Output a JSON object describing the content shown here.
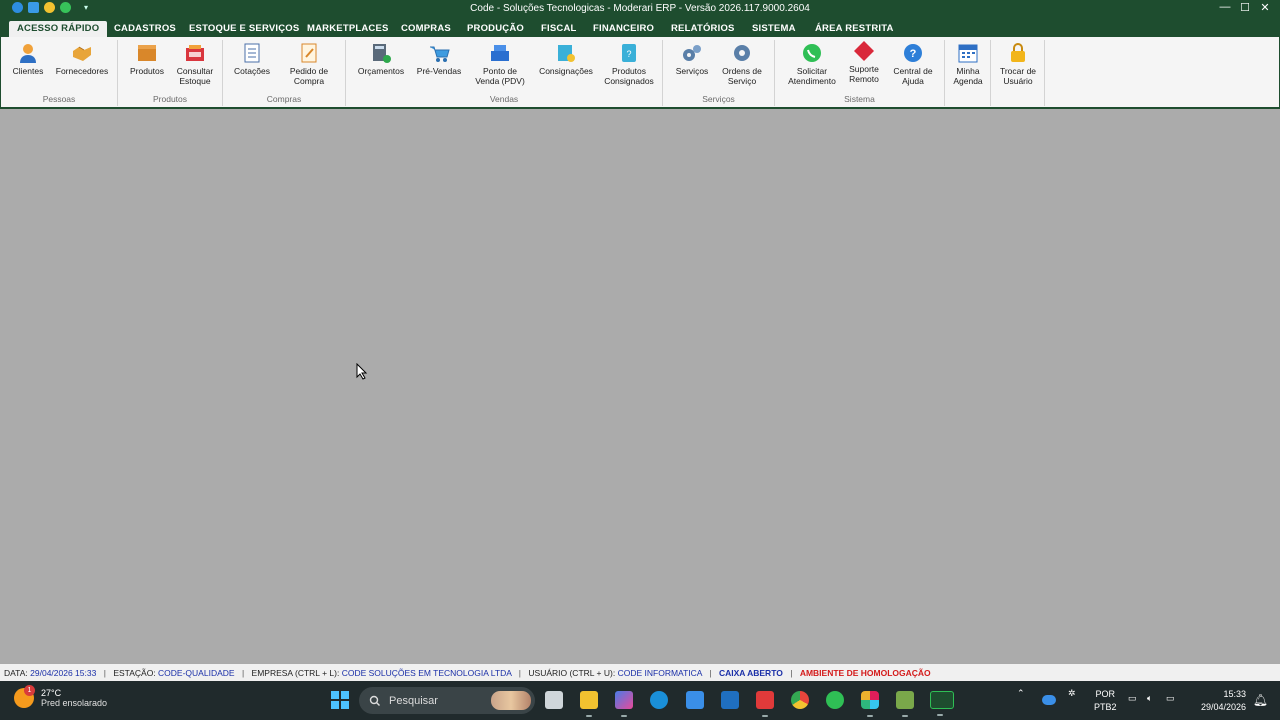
{
  "window": {
    "title": "Code - Soluções Tecnologicas - Moderari ERP - Versão 2026.117.9000.2604",
    "quick_access_caret": "▾",
    "controls": {
      "minimize": "—",
      "maximize": "☐",
      "close": "✕"
    }
  },
  "menu": {
    "tabs": [
      "ACESSO RÁPIDO",
      "CADASTROS",
      "ESTOQUE E SERVIÇOS",
      "MARKETPLACES",
      "COMPRAS",
      "PRODUÇÃO",
      "FISCAL",
      "FINANCEIRO",
      "RELATÓRIOS",
      "SISTEMA",
      "ÁREA RESTRITA"
    ],
    "active_tab": "ACESSO RÁPIDO"
  },
  "ribbon": {
    "groups": {
      "pessoas": {
        "label": "Pessoas",
        "buttons": [
          "Clientes",
          "Fornecedores"
        ]
      },
      "produtos": {
        "label": "Produtos",
        "buttons": [
          "Produtos",
          "Consultar Estoque"
        ]
      },
      "compras": {
        "label": "Compras",
        "buttons": [
          "Cotações",
          "Pedido de Compra"
        ]
      },
      "vendas": {
        "label": "Vendas",
        "buttons": [
          "Orçamentos",
          "Pré-Vendas",
          "Ponto de Venda (PDV)",
          "Consignações",
          "Produtos Consignados"
        ]
      },
      "servicos": {
        "label": "Serviços",
        "buttons": [
          "Serviços",
          "Ordens de Serviço"
        ]
      },
      "sistema": {
        "label": "Sistema",
        "buttons": [
          "Solicitar Atendimento",
          "Suporte Remoto",
          "Central de Ajuda"
        ]
      },
      "extra": {
        "label": "",
        "buttons": [
          "Minha Agenda",
          "Trocar de Usuário"
        ]
      }
    }
  },
  "statusbar": {
    "data_label": "DATA:",
    "data_value": "29/04/2026 15:33",
    "estacao_label": "ESTAÇÃO:",
    "estacao_value": "CODE-QUALIDADE",
    "empresa_label": "EMPRESA (CTRL + L):",
    "empresa_value": "CODE SOLUÇÕES EM TECNOLOGIA LTDA",
    "usuario_label": "USUÁRIO (CTRL + U):",
    "usuario_value": "CODE INFORMATICA",
    "caixa": "CAIXA ABERTO",
    "ambiente": "AMBIENTE DE HOMOLOGAÇÃO",
    "separator": "|"
  },
  "taskbar": {
    "weather_temp": "27°C",
    "weather_desc": "Pred ensolarado",
    "weather_badge": "1",
    "search_placeholder": "Pesquisar",
    "language_line1": "POR",
    "language_line2": "PTB2",
    "time": "15:33",
    "date": "29/04/2026"
  },
  "colors": {
    "title_green": "#1e4d2f",
    "status_value_blue": "#1a2fa8",
    "status_alert_red": "#d41a1a"
  }
}
